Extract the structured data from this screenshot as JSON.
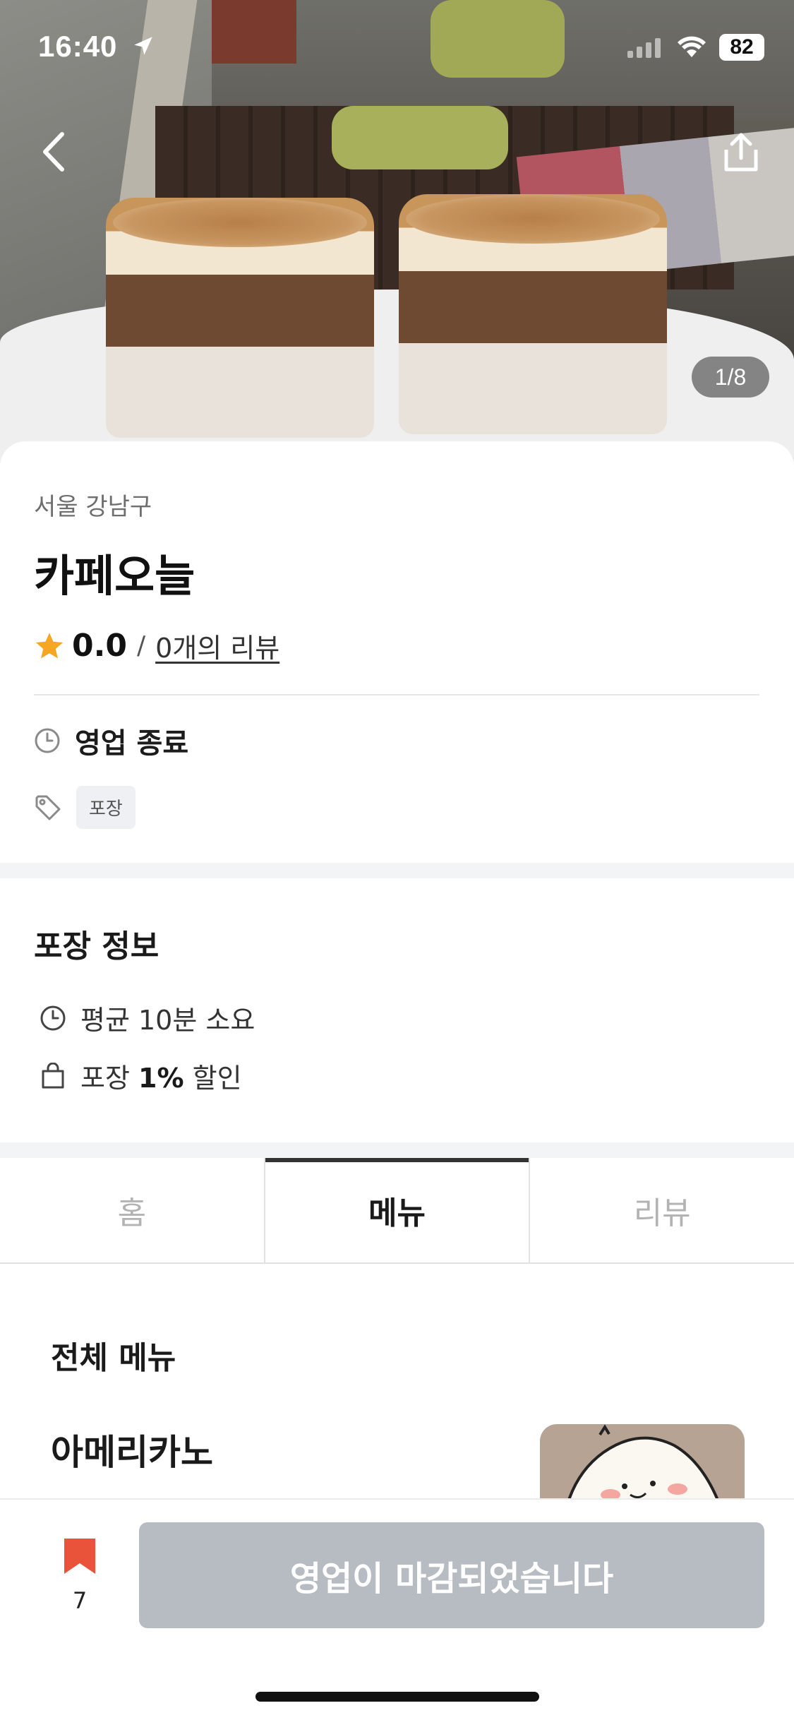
{
  "status_bar": {
    "time": "16:40",
    "battery": "82"
  },
  "photo": {
    "counter": "1/8"
  },
  "store": {
    "region": "서울 강남구",
    "name": "카페오늘",
    "rating": "0.0",
    "rating_separator": "/",
    "review_link": "0개의 리뷰",
    "hours_status": "영업 종료",
    "tag": "포장",
    "star_color": "#f5a623"
  },
  "takeout": {
    "title": "포장 정보",
    "avg_time": "평균 10분 소요",
    "discount_prefix": "포장",
    "discount_value": "1%",
    "discount_suffix": "할인"
  },
  "tabs": [
    {
      "label": "홈",
      "active": false
    },
    {
      "label": "메뉴",
      "active": true
    },
    {
      "label": "리뷰",
      "active": false
    }
  ],
  "menu": {
    "heading": "전체 메뉴",
    "items": [
      {
        "name": "아메리카노"
      }
    ]
  },
  "bottom_bar": {
    "bookmark_count": "7",
    "bookmark_color": "#e8533a",
    "closed_button_label": "영업이 마감되었습니다"
  }
}
